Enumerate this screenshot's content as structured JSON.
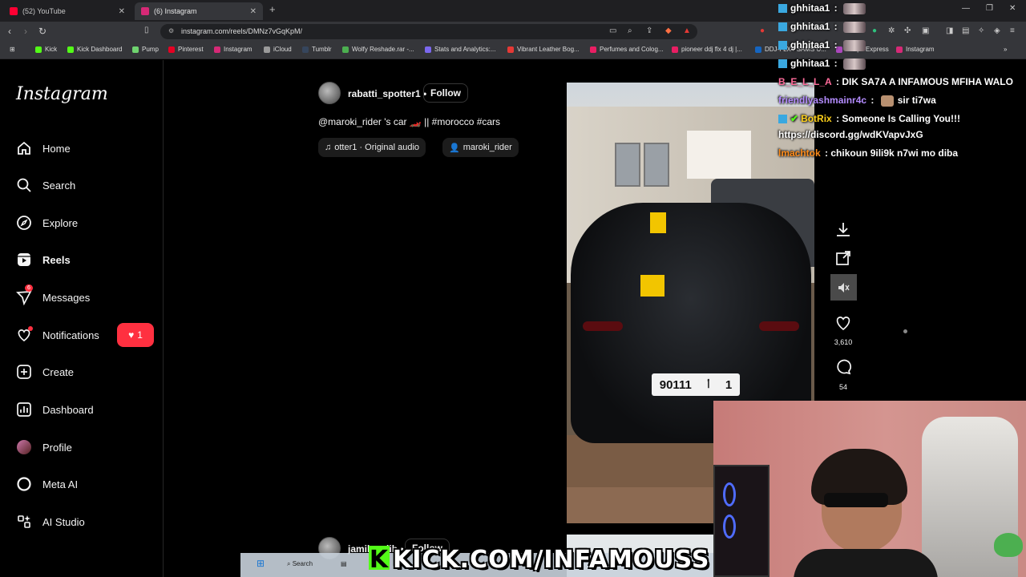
{
  "browser": {
    "tabs": [
      {
        "label": "(52) YouTube",
        "color": "#ff0033"
      },
      {
        "label": "(6) Instagram",
        "color": "#d62976"
      }
    ],
    "url": "instagram.com/reels/DMNz7vGqKpM/",
    "bookmarks": [
      {
        "label": "Kick",
        "color": "#53fc18"
      },
      {
        "label": "Kick Dashboard",
        "color": "#53fc18"
      },
      {
        "label": "Pump",
        "color": "#6fd36f"
      },
      {
        "label": "Pinterest",
        "color": "#e60023"
      },
      {
        "label": "Instagram",
        "color": "#d62976"
      },
      {
        "label": "iCloud",
        "color": "#9a9a9a"
      },
      {
        "label": "Tumblr",
        "color": "#36465d"
      },
      {
        "label": "Wolfy Reshade.rar -...",
        "color": "#4caf50"
      },
      {
        "label": "Stats and Analytics:...",
        "color": "#7b68ee"
      },
      {
        "label": "Vibrant Leather Bog...",
        "color": "#e53935"
      },
      {
        "label": "Perfumes and Colog...",
        "color": "#e91e63"
      },
      {
        "label": "pioneer ddj flx 4 dj |...",
        "color": "#e91e63"
      },
      {
        "label": "DDJ-FLX4 SAMS U...",
        "color": "#1565c0"
      },
      {
        "label": "Seeps Express",
        "color": "#ab47bc"
      },
      {
        "label": "Instagram",
        "color": "#d62976"
      }
    ]
  },
  "sidebar": {
    "logo": "Instagram",
    "items": [
      {
        "label": "Home",
        "icon": "home-icon"
      },
      {
        "label": "Search",
        "icon": "search-icon"
      },
      {
        "label": "Explore",
        "icon": "compass-icon"
      },
      {
        "label": "Reels",
        "icon": "reels-icon"
      },
      {
        "label": "Messages",
        "icon": "messenger-icon",
        "badge": "6"
      },
      {
        "label": "Notifications",
        "icon": "heart-icon"
      },
      {
        "label": "Create",
        "icon": "plus-square-icon"
      },
      {
        "label": "Dashboard",
        "icon": "dashboard-icon"
      },
      {
        "label": "Profile",
        "icon": "avatar"
      },
      {
        "label": "Meta AI",
        "icon": "meta-ai-icon"
      },
      {
        "label": "AI Studio",
        "icon": "ai-studio-icon"
      }
    ],
    "notification_pill_count": "1"
  },
  "post": {
    "username": "rabatti_spotter1",
    "follow_label": "Follow",
    "caption": "@maroki_rider 's car 🏎️ || #morocco #cars",
    "audio_chip": "otter1 · Original audio",
    "tag_chip": "maroki_rider",
    "likes": "3,610",
    "comments": "54",
    "plate_number": "90111",
    "plate_letter": "أ",
    "plate_region": "1"
  },
  "next_post": {
    "username": "jamil_najib",
    "follow_label": "Follow"
  },
  "chat": {
    "lines": [
      {
        "user": "ghhitaa1",
        "color": "#ffffff",
        "text": ""
      },
      {
        "user": "ghhitaa1",
        "color": "#ffffff",
        "text": ""
      },
      {
        "user": "ghhitaa1",
        "color": "#ffffff",
        "text": ""
      },
      {
        "user": "ghhitaa1",
        "color": "#ffffff",
        "text": ""
      },
      {
        "user": "B_E_L_L_A",
        "color": "#ff6b9a",
        "text": "DIK SA7A A INFAMOUS MFIHA WALO"
      },
      {
        "user": "friendlyashmainr4c",
        "color": "#b48cff",
        "text": "sir ti7wa"
      },
      {
        "user": "BotRix",
        "color": "#ffd11a",
        "text": "Someone Is Calling You!!!"
      },
      {
        "user": "",
        "color": "#ffffff",
        "text": "https://discord.gg/wdKVapvJxG"
      },
      {
        "user": "lmachtok",
        "color": "#ff8c1a",
        "text": "chikoun 9ili9k n7wi mo diba"
      }
    ]
  },
  "overlay": {
    "banner": "KICK.COM/INFAMOUSS",
    "taskbar_search": "Search"
  }
}
